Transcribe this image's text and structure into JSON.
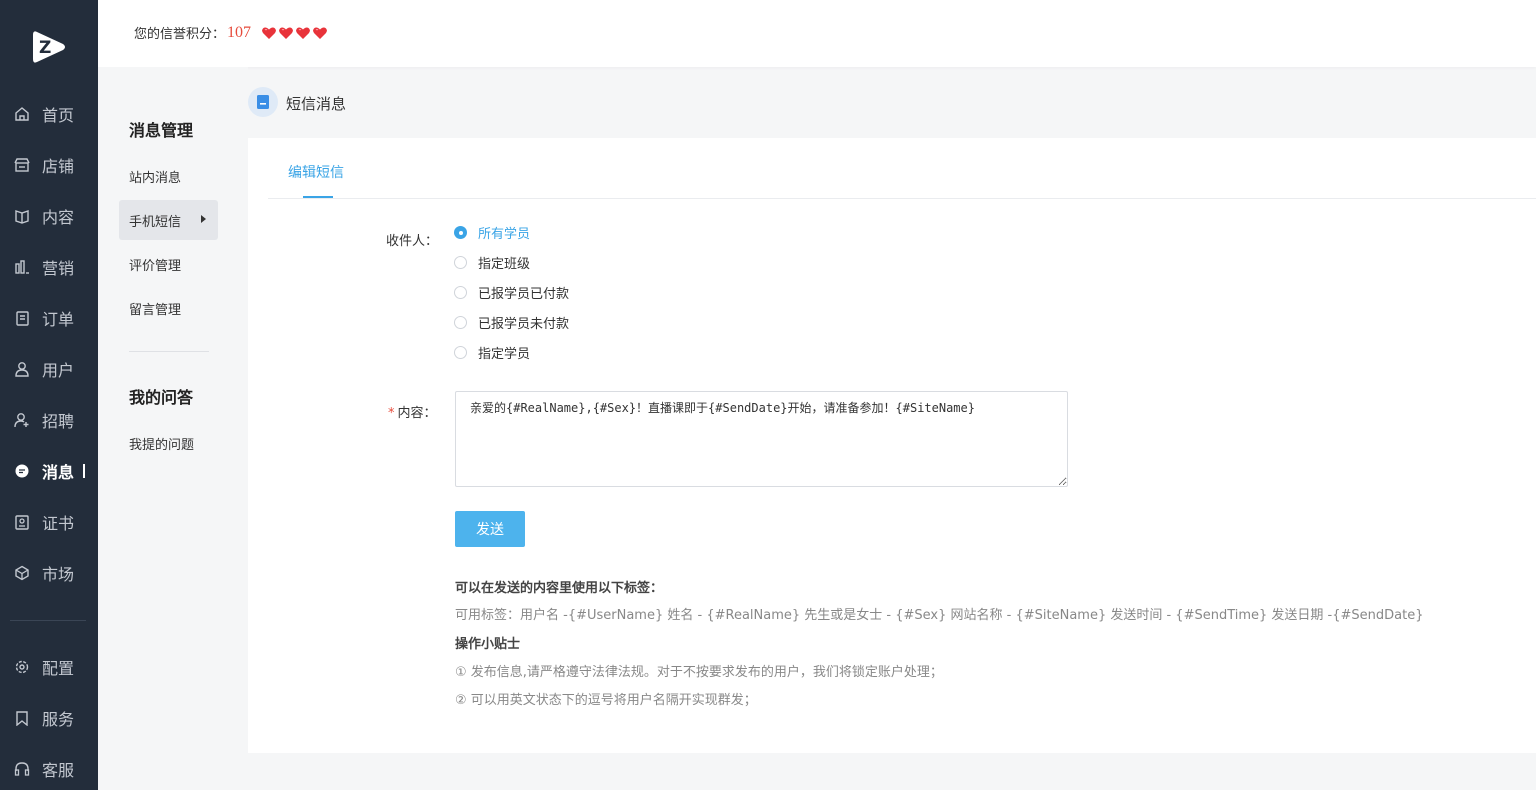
{
  "nav": {
    "items": [
      {
        "label": "首页",
        "icon": "home-icon"
      },
      {
        "label": "店铺",
        "icon": "store-icon"
      },
      {
        "label": "内容",
        "icon": "book-icon"
      },
      {
        "label": "营销",
        "icon": "bar-chart-icon"
      },
      {
        "label": "订单",
        "icon": "order-icon"
      },
      {
        "label": "用户",
        "icon": "user-icon"
      },
      {
        "label": "招聘",
        "icon": "user-add-icon"
      },
      {
        "label": "消息",
        "icon": "message-icon"
      },
      {
        "label": "证书",
        "icon": "certificate-icon"
      },
      {
        "label": "市场",
        "icon": "cube-icon"
      },
      {
        "label": "配置",
        "icon": "gear-icon"
      },
      {
        "label": "服务",
        "icon": "bookmark-icon"
      },
      {
        "label": "客服",
        "icon": "headset-icon"
      }
    ],
    "active": "消息"
  },
  "header": {
    "credit_label": "您的信誉积分：",
    "credit_value": "107",
    "hearts": 4,
    "heart_color": "#e8333a"
  },
  "subnav": {
    "group1_title": "消息管理",
    "group1_items": [
      "站内消息",
      "手机短信",
      "评价管理",
      "留言管理"
    ],
    "active": "手机短信",
    "group2_title": "我的问答",
    "group2_items": [
      "我提的问题"
    ]
  },
  "page": {
    "title": "短信消息",
    "tab": "编辑短信"
  },
  "form": {
    "recipient_label": "收件人：",
    "recipients": [
      "所有学员",
      "指定班级",
      "已报学员已付款",
      "已报学员未付款",
      "指定学员"
    ],
    "recipient_selected": "所有学员",
    "content_required_mark": "*",
    "content_label": "内容：",
    "content_value": "亲爱的{#RealName},{#Sex}！直播课即于{#SendDate}开始，请准备参加！{#SiteName}",
    "send_button": "发送"
  },
  "tips": {
    "tags_title": "可以在发送的内容里使用以下标签：",
    "tags_text": "可用标签：用户名 -{#UserName} 姓名 - {#RealName} 先生或是女士 - {#Sex} 网站名称 - {#SiteName} 发送时间 - {#SendTime} 发送日期 -{#SendDate}",
    "hint_title": "操作小贴士",
    "hint1": "① 发布信息,请严格遵守法律法规。对于不按要求发布的用户，我们将锁定账户处理；",
    "hint2": "② 可以用英文状态下的逗号将用户名隔开实现群发；"
  },
  "colors": {
    "nav_bg": "#232d3b",
    "accent": "#3aa4e6",
    "button": "#4db3ed",
    "credit_value": "#e64c3c"
  }
}
